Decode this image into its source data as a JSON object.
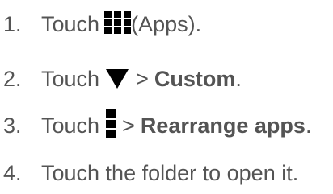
{
  "steps": [
    {
      "number": "1.",
      "text_before": "Touch",
      "icon": "apps-grid-icon",
      "text_after": "(Apps)."
    },
    {
      "number": "2.",
      "text_before": "Touch",
      "icon": "down-triangle-icon",
      "separator": ">",
      "emphasis": "Custom",
      "text_after": "."
    },
    {
      "number": "3.",
      "text_before": "Touch",
      "icon": "menu-icon",
      "separator": ">",
      "emphasis": "Rearrange apps",
      "text_after": "."
    },
    {
      "number": "4.",
      "text": "Touch the folder to open it."
    }
  ],
  "colors": {
    "text": "#545454",
    "icon": "#000000"
  }
}
